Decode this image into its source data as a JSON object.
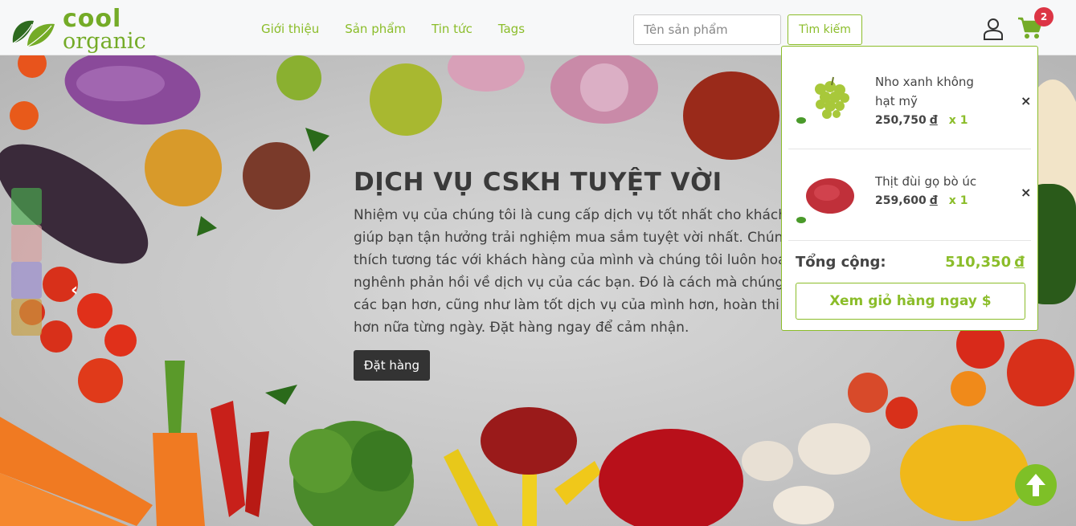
{
  "header": {
    "logo": {
      "line1": "cool",
      "line2": "organic"
    },
    "nav": [
      {
        "label": "Giới thiệu"
      },
      {
        "label": "Sản phẩm"
      },
      {
        "label": "Tin tức"
      },
      {
        "label": "Tags"
      }
    ],
    "search": {
      "placeholder": "Tên sản phẩm",
      "button_label": "Tìm kiếm"
    },
    "cart_count": "2",
    "icons": {
      "user": "user-icon",
      "cart": "cart-icon"
    }
  },
  "hero": {
    "title": "DỊCH VỤ CSKH TUYỆT VỜI",
    "description": "Nhiệm vụ của chúng tôi là cung cấp dịch vụ tốt nhất cho khách\ngiúp bạn tận hưởng trải nghiệm mua sắm tuyệt vời nhất. Chúng\nthích tương tác với khách hàng của mình và chúng tôi luôn hoa\nnghênh phản hồi về dịch vụ của các bạn. Đó là cách mà chúng\ncác bạn hơn, cũng như làm tốt dịch vụ của mình hơn, hoàn thi\nhơn nữa từng ngày. Đặt hàng ngay để cảm nhận.",
    "order_button": "Đặt hàng",
    "prev_arrow": "‹"
  },
  "cart": {
    "items": [
      {
        "name": "Nho xanh không hạt mỹ",
        "price": "250,750",
        "currency": "đ",
        "qty": "x 1",
        "remove": "×"
      },
      {
        "name": "Thịt đùi gọ bò úc",
        "price": "259,600",
        "currency": "đ",
        "qty": "x 1",
        "remove": "×"
      }
    ],
    "total_label": "Tổng cộng:",
    "total_value": "510,350",
    "total_currency": "đ",
    "view_button": "Xem giỏ hàng ngay $"
  },
  "colors": {
    "accent": "#8bbd2a",
    "badge": "#dc3545",
    "dark_button": "#333333"
  }
}
